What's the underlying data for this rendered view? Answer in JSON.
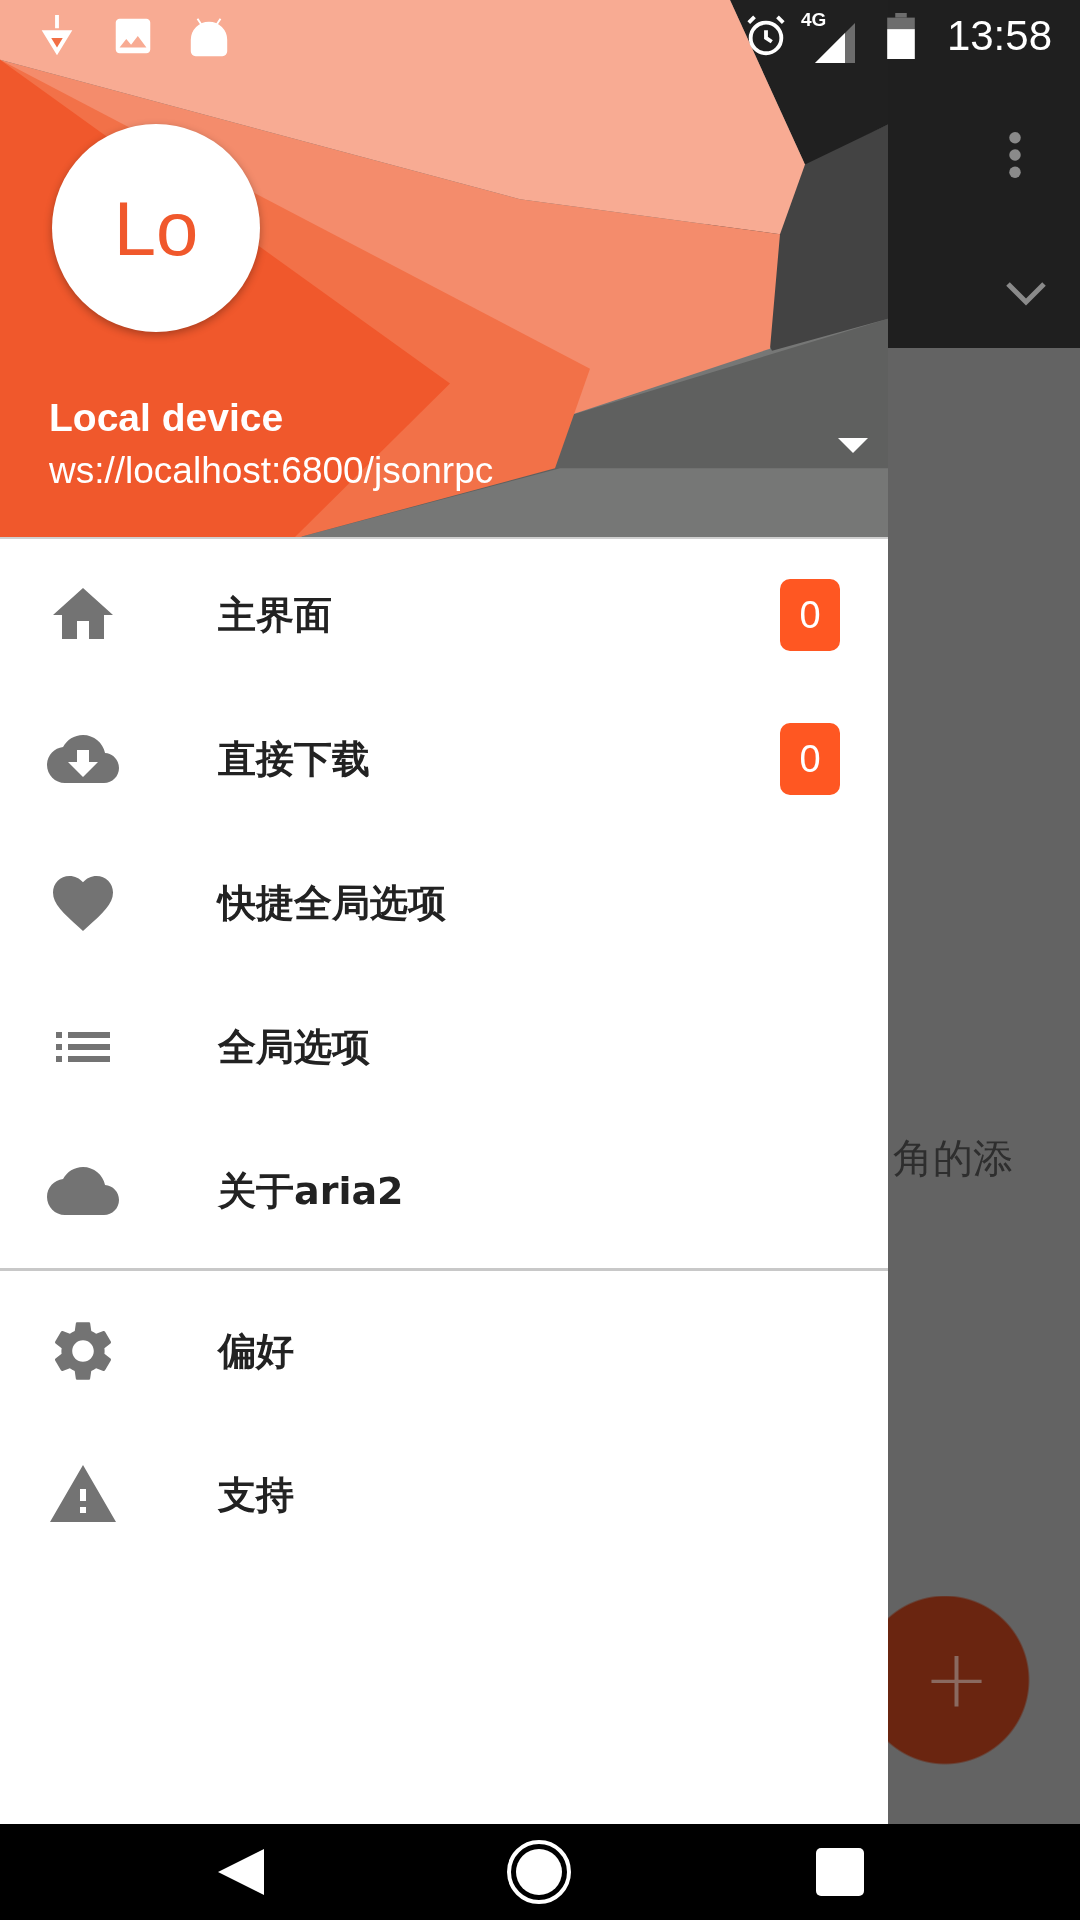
{
  "status_bar": {
    "network": "4G",
    "time": "13:58"
  },
  "header": {
    "avatar_text": "Lo",
    "account_name": "Local device",
    "account_url": "ws://localhost:6800/jsonrpc"
  },
  "primary_items": [
    {
      "label": "主界面",
      "badge": "0"
    },
    {
      "label": "直接下载",
      "badge": "0"
    },
    {
      "label": "快捷全局选项"
    },
    {
      "label": "全局选项"
    },
    {
      "label": "关于aria2"
    }
  ],
  "secondary_items": [
    {
      "label": "偏好"
    },
    {
      "label": "支持"
    }
  ],
  "background_app": {
    "hint_text": "角的添",
    "fab_label": "+"
  }
}
